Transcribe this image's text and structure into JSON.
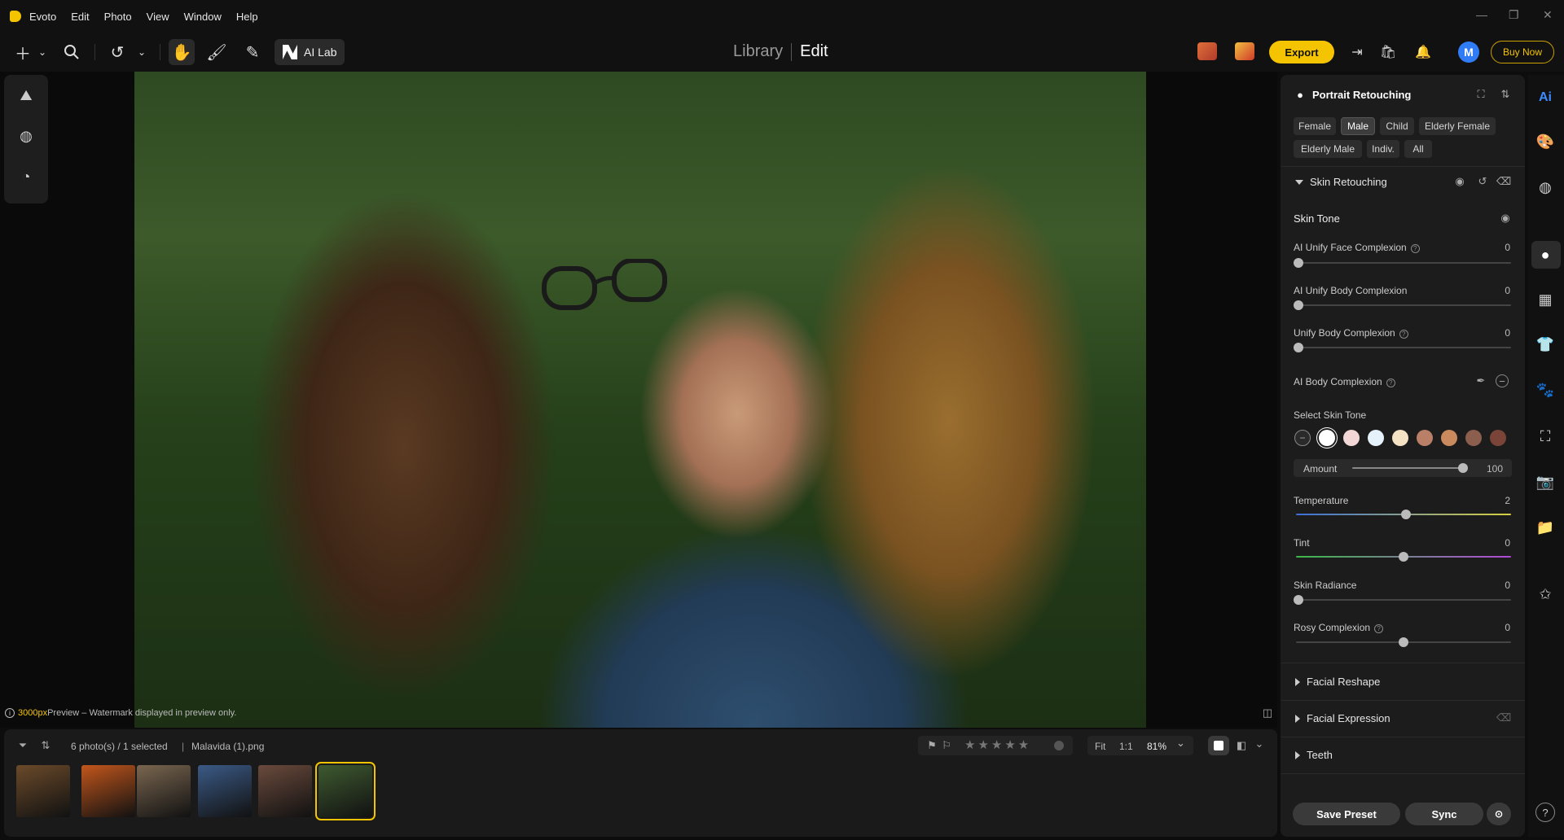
{
  "app": {
    "name": "Evoto",
    "menus": [
      "Edit",
      "Photo",
      "View",
      "Window",
      "Help"
    ],
    "window_controls": [
      "—",
      "❐",
      "✕"
    ]
  },
  "toolbar": {
    "ai_lab_label": "AI Lab",
    "mode_library": "Library",
    "mode_edit": "Edit",
    "export_label": "Export",
    "avatar_initial": "M",
    "buy_now_label": "Buy Now"
  },
  "canvas": {
    "preview_px": "3000px",
    "preview_note": " Preview – Watermark displayed in preview only."
  },
  "filmstrip": {
    "count_text": "6 photo(s) / 1 selected",
    "filename": "Malavida (1).png",
    "fit_label": "Fit",
    "one_to_one_label": "1:1",
    "zoom_value": "81%",
    "thumbnails": [
      {
        "color": "#6b4a2a"
      },
      {
        "color": "#c2561c"
      },
      {
        "color": "#7a6650"
      },
      {
        "color": "#3b5a86"
      },
      {
        "color": "#6a4a3c"
      },
      {
        "color": "#3e5a30"
      }
    ]
  },
  "panel": {
    "title": "Portrait Retouching",
    "presets": [
      "Female",
      "Male",
      "Child",
      "Elderly Female",
      "Elderly Male",
      "Indiv.",
      "All"
    ],
    "active_preset": "Male",
    "skin_retouching": "Skin Retouching",
    "skin_tone": "Skin Tone",
    "sliders": [
      {
        "label": "AI Unify Face Complexion",
        "value": "0",
        "help": true
      },
      {
        "label": "AI Unify Body Complexion",
        "value": "0",
        "help": false
      },
      {
        "label": "Unify Body Complexion",
        "value": "0",
        "help": true
      }
    ],
    "ai_body_complexion": "AI Body Complexion",
    "select_skin_tone": "Select Skin Tone",
    "swatches": [
      "#2a2a2a",
      "#ffffff",
      "#f3d6d6",
      "#e6f2fb",
      "#f5e1c4",
      "#b98067",
      "#c98a5e",
      "#8c5e4e",
      "#7a4538"
    ],
    "amount_label": "Amount",
    "amount_value": "100",
    "amount_fraction": 1.0,
    "temperature_label": "Temperature",
    "temperature_value": "2",
    "tint_label": "Tint",
    "tint_value": "0",
    "skin_radiance_label": "Skin Radiance",
    "skin_radiance_value": "0",
    "rosy_label": "Rosy Complexion",
    "rosy_value": "0",
    "sections": [
      "Facial Reshape",
      "Facial Expression",
      "Teeth"
    ],
    "save_preset": "Save Preset",
    "sync": "Sync"
  },
  "right_rail_icons": [
    "ai-icon",
    "palette-icon",
    "texture-icon",
    "face-icon",
    "grid-icon",
    "shirt-icon",
    "paw-icon",
    "crop-icon",
    "camera-icon",
    "folder-icon",
    "star-icon",
    "help-icon"
  ],
  "help_label": "?"
}
